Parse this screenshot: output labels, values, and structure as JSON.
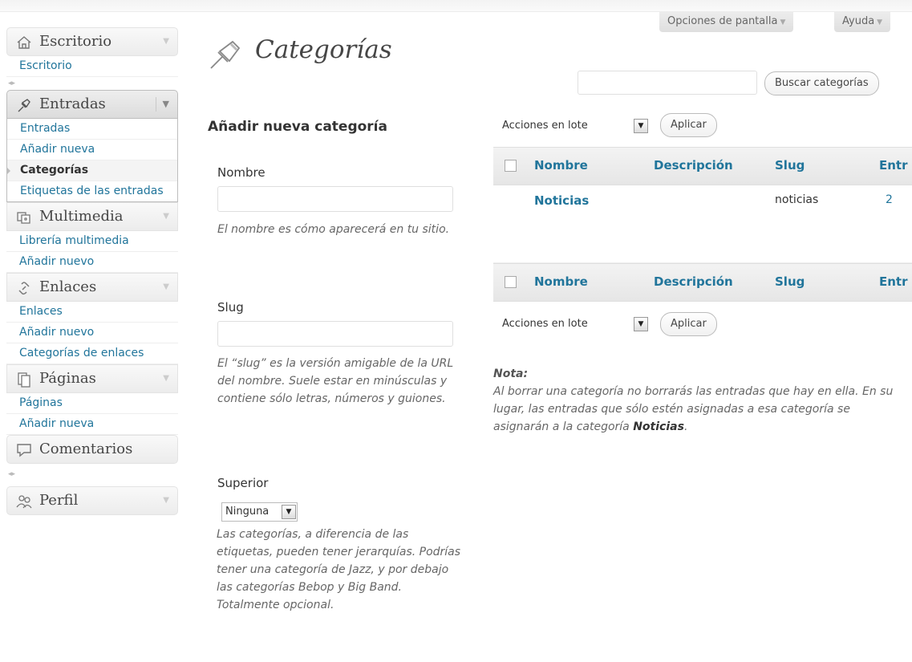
{
  "header": {
    "screen_options": "Opciones de pantalla",
    "help": "Ayuda",
    "title": "Categorías",
    "search_button": "Buscar categorías"
  },
  "sidebar": {
    "dashboard": {
      "label": "Escritorio",
      "items": [
        "Escritorio"
      ]
    },
    "posts": {
      "label": "Entradas",
      "items": [
        "Entradas",
        "Añadir nueva",
        "Categorías",
        "Etiquetas de las entradas"
      ]
    },
    "media": {
      "label": "Multimedia",
      "items": [
        "Librería multimedia",
        "Añadir nuevo"
      ]
    },
    "links": {
      "label": "Enlaces",
      "items": [
        "Enlaces",
        "Añadir nuevo",
        "Categorías de enlaces"
      ]
    },
    "pages": {
      "label": "Páginas",
      "items": [
        "Páginas",
        "Añadir nueva"
      ]
    },
    "comments": {
      "label": "Comentarios"
    },
    "profile": {
      "label": "Perfil"
    }
  },
  "form": {
    "heading": "Añadir nueva categoría",
    "name_label": "Nombre",
    "name_value": "",
    "name_desc": "El nombre es cómo aparecerá en tu sitio.",
    "slug_label": "Slug",
    "slug_value": "",
    "slug_desc": "El “slug” es la versión amigable de la URL del nombre. Suele estar en minúsculas y contiene sólo letras, números y guiones.",
    "parent_label": "Superior",
    "parent_value": "Ninguna",
    "parent_desc": "Las categorías, a diferencia de las etiquetas, pueden tener jerarquías. Podrías tener una categoría de Jazz, y por debajo las categorías Bebop y Big Band. Totalmente opcional."
  },
  "bulk": {
    "actions": "Acciones en lote",
    "apply": "Aplicar"
  },
  "table": {
    "columns": [
      "Nombre",
      "Descripción",
      "Slug",
      "Entr"
    ],
    "rows": [
      {
        "name": "Noticias",
        "description": "",
        "slug": "noticias",
        "count": "2"
      }
    ]
  },
  "note": {
    "title": "Nota:",
    "text": "Al borrar una categoría no borrarás las entradas que hay en ella. En su lugar, las entradas que sólo estén asignadas a esa categoría se asignarán a la categoría",
    "category": "Noticias"
  },
  "colors": {
    "link": "#21759b",
    "text": "#333333",
    "muted": "#666666"
  }
}
